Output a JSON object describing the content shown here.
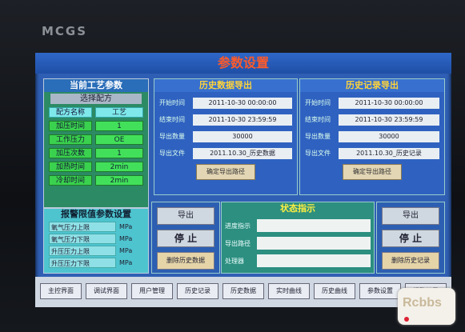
{
  "device_brand": "MCGS",
  "title": "参数设置",
  "left_panel": {
    "header": "当前工艺参数",
    "select_label": "选择配方",
    "rows": [
      {
        "label": "配方名称",
        "value": "工艺"
      },
      {
        "label": "加压时间",
        "value": "1"
      },
      {
        "label": "工作压力",
        "value": "OE"
      },
      {
        "label": "加压次数",
        "value": "1"
      },
      {
        "label": "加热时间",
        "value": "2min"
      },
      {
        "label": "冷却时间",
        "value": "2min"
      }
    ]
  },
  "alarm_panel": {
    "header": "报警限值参数设置",
    "rows": [
      {
        "label": "氧气压力上限",
        "unit": "MPa"
      },
      {
        "label": "氧气压力下限",
        "unit": "MPa"
      },
      {
        "label": "升压压力上限",
        "unit": "MPa"
      },
      {
        "label": "升压压力下限",
        "unit": "MPa"
      }
    ]
  },
  "history_export": {
    "header": "历史数据导出",
    "rows": [
      {
        "label": "开始时间",
        "value": "2011-10-30 00:00:00"
      },
      {
        "label": "结束时间",
        "value": "2011-10-30 23:59:59"
      },
      {
        "label": "导出数量",
        "value": "30000"
      },
      {
        "label": "导出文件",
        "value": "2011.10.30_历史数据"
      }
    ],
    "button": "确定导出路径"
  },
  "history_record": {
    "header": "历史记录导出",
    "rows": [
      {
        "label": "开始时间",
        "value": "2011-10-30 00:00:00"
      },
      {
        "label": "结束时间",
        "value": "2011-10-30 23:59:59"
      },
      {
        "label": "导出数量",
        "value": "30000"
      },
      {
        "label": "导出文件",
        "value": "2011.10.30_历史记录"
      }
    ],
    "button": "确定导出路径"
  },
  "status": {
    "header": "状态指示",
    "rows": [
      {
        "label": "进度指示"
      },
      {
        "label": "导出路径"
      },
      {
        "label": "处理器"
      }
    ]
  },
  "controls_left": {
    "export": "导出",
    "stop": "停 止",
    "delete": "删除历史数据"
  },
  "controls_right": {
    "export": "导出",
    "stop": "停 止",
    "delete": "删除历史记录"
  },
  "nav": [
    "主控界面",
    "调试界面",
    "用户管理",
    "历史记录",
    "历史数据",
    "实时曲线",
    "历史曲线",
    "参数设置",
    "报警记录"
  ],
  "watermark": "Rcbbs"
}
